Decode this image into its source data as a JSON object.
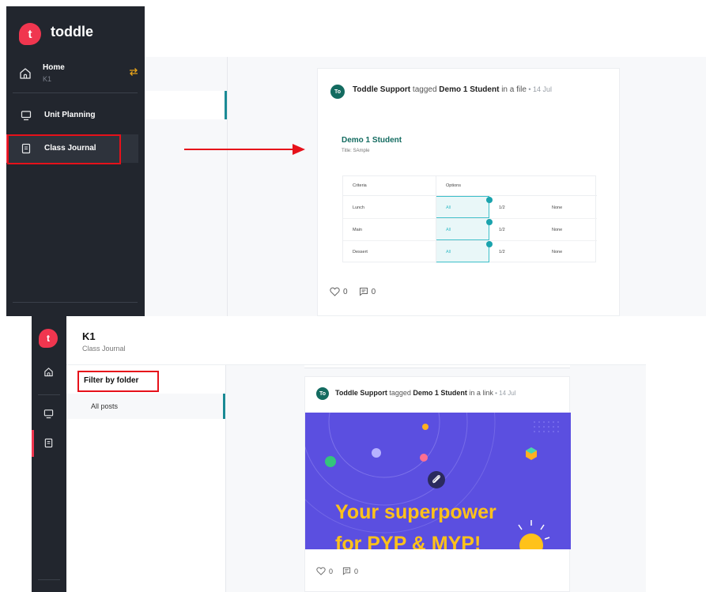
{
  "top": {
    "brand": "toddle",
    "logo_letter": "t",
    "home": {
      "label": "Home",
      "sub": "K1"
    },
    "nav": [
      {
        "label": "Unit Planning",
        "icon": "monitor-icon"
      },
      {
        "label": "Class Journal",
        "icon": "journal-icon",
        "active": true
      }
    ],
    "post": {
      "avatar": "To",
      "author": "Toddle Support",
      "verb": " tagged ",
      "student": "Demo 1 Student",
      "rest": " in a file",
      "date": " • 14 Jul",
      "doc_title": "Demo 1 Student",
      "doc_sub": "Title: SAmple",
      "rubric": {
        "headers": [
          "Criteria",
          "Options"
        ],
        "rows": [
          {
            "criteria": "Lunch",
            "options": [
              "All",
              "1/2",
              "None"
            ]
          },
          {
            "criteria": "Main",
            "options": [
              "All",
              "1/2",
              "None"
            ]
          },
          {
            "criteria": "Dessert",
            "options": [
              "All",
              "1/2",
              "None"
            ]
          }
        ]
      },
      "likes": "0",
      "comments": "0"
    }
  },
  "bottom": {
    "logo_letter": "t",
    "header": {
      "title": "K1",
      "sub": "Class Journal"
    },
    "filter": {
      "label": "Filter by folder",
      "items": [
        "All posts"
      ]
    },
    "post": {
      "avatar": "To",
      "author": "Toddle Support",
      "verb": " tagged ",
      "student": "Demo 1 Student",
      "rest": " in a link",
      "date": " • 14 Jul",
      "banner_line1": "Your superpower",
      "banner_line2": "for PYP & MYP!",
      "likes": "0",
      "comments": "0"
    }
  },
  "colors": {
    "sidebar": "#22262e",
    "brand_red": "#f0364f",
    "accent_teal": "#1a8a95",
    "annotation_red": "#e6111a",
    "banner_purple": "#5b4fe0",
    "banner_yellow": "#ffc21a"
  }
}
